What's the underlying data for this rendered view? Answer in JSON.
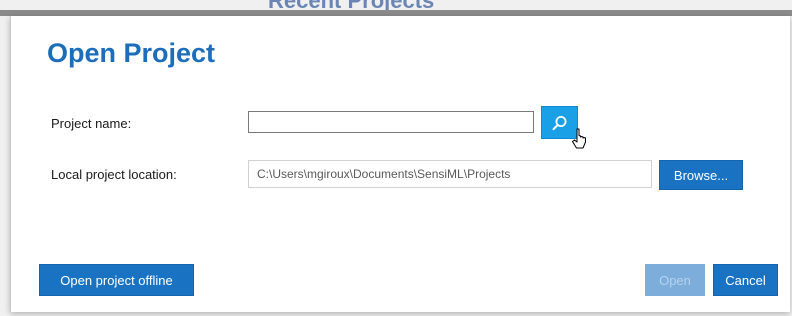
{
  "background": {
    "title": "Recent Projects"
  },
  "dialog": {
    "title": "Open Project",
    "project_name": {
      "label": "Project name:",
      "value": "",
      "search_icon": "search-icon"
    },
    "location": {
      "label": "Local project location:",
      "value": "C:\\Users\\mgiroux\\Documents\\SensiML\\Projects",
      "browse_label": "Browse..."
    },
    "footer": {
      "offline_label": "Open project offline",
      "open_label": "Open",
      "cancel_label": "Cancel"
    }
  },
  "colors": {
    "accent": "#1a73c2",
    "title": "#1c6ebb",
    "search_button": "#1aa0e6",
    "disabled_button": "#7daedb"
  }
}
